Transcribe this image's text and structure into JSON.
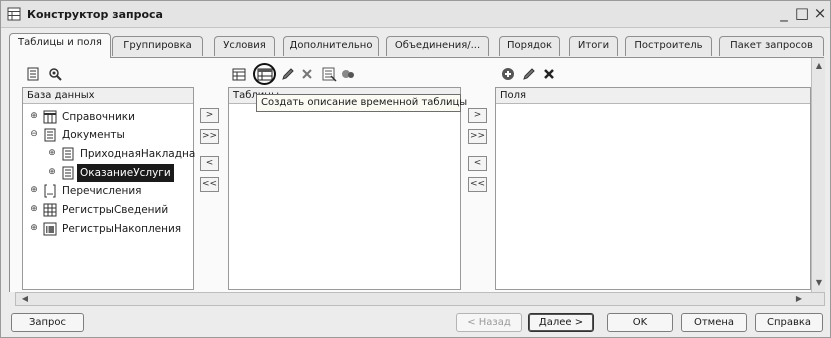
{
  "window": {
    "title": "Конструктор запроса",
    "minimize_glyph": "_",
    "maximize_glyph": "□",
    "close_glyph": "×"
  },
  "tabs": [
    {
      "label": "Таблицы и поля",
      "active": true
    },
    {
      "label": "Группировка"
    },
    {
      "label": "Условия"
    },
    {
      "label": "Дополнительно"
    },
    {
      "label": "Объединения/..."
    },
    {
      "label": "Порядок"
    },
    {
      "label": "Итоги"
    },
    {
      "label": "Построитель"
    },
    {
      "label": "Пакет запросов"
    }
  ],
  "database_panel": {
    "header": "База данных",
    "items": [
      {
        "label": "Справочники",
        "icon": "catalog-icon",
        "expander": "⊕"
      },
      {
        "label": "Документы",
        "icon": "document-icon",
        "expander": "⊖"
      },
      {
        "label": "ПриходнаяНакладна",
        "icon": "document-icon",
        "expander": "⊕"
      },
      {
        "label": "ОказаниеУслуги",
        "icon": "document-icon",
        "expander": "⊕",
        "selected": true
      },
      {
        "label": "Перечисления",
        "icon": "enum-icon",
        "expander": "⊕"
      },
      {
        "label": "РегистрыСведений",
        "icon": "info-register-icon",
        "expander": "⊕"
      },
      {
        "label": "РегистрыНакопления",
        "icon": "accum-register-icon",
        "expander": "⊕"
      }
    ]
  },
  "tables_panel": {
    "header": "Таблицы"
  },
  "fields_panel": {
    "header": "Поля"
  },
  "tooltip": {
    "text": "Создать описание временной таблицы"
  },
  "move_buttons": {
    "add_one": ">",
    "add_all": ">>",
    "remove_one": "<",
    "remove_all": "<<"
  },
  "footer": {
    "query_button": "Запрос",
    "back_button": "< Назад",
    "next_button": "Далее >",
    "ok_button": "OK",
    "cancel_button": "Отмена",
    "help_button": "Справка"
  },
  "colors": {
    "selection_bg": "#1a1a1a",
    "panel_bg": "#ffffff",
    "window_bg": "#ececec"
  }
}
